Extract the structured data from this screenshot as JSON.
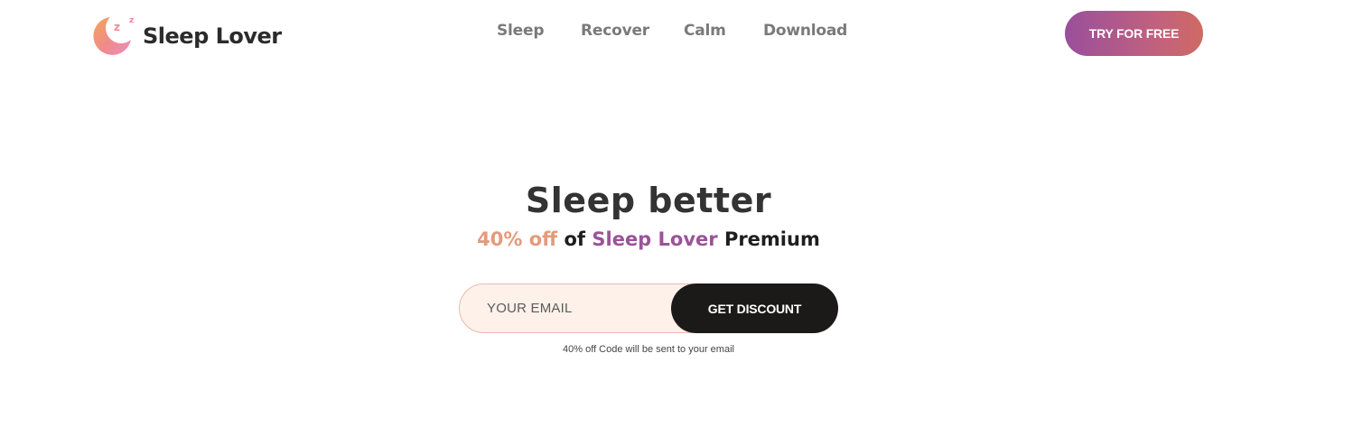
{
  "brand": {
    "name": "Sleep Lover",
    "logo_icon": "moon-zzz-icon",
    "colors": {
      "peach": "#e49a7c",
      "purple": "#9a5399",
      "cta_gradient_start": "#9a4f9c",
      "cta_gradient_end": "#cf6a63",
      "dark_button": "#1c1a19",
      "input_bg": "#fdf1ea"
    }
  },
  "nav": {
    "items": [
      {
        "label": "Sleep"
      },
      {
        "label": "Recover"
      },
      {
        "label": "Calm"
      },
      {
        "label": "Download"
      }
    ],
    "cta_label": "TRY FOR FREE"
  },
  "hero": {
    "title": "Sleep better",
    "subtitle": {
      "discount": "40% off",
      "of": "of",
      "product": "Sleep Lover",
      "tier": "Premium"
    },
    "email_placeholder": "YOUR EMAIL",
    "submit_label": "GET DISCOUNT",
    "note": "40% off Code will be sent to your email"
  }
}
